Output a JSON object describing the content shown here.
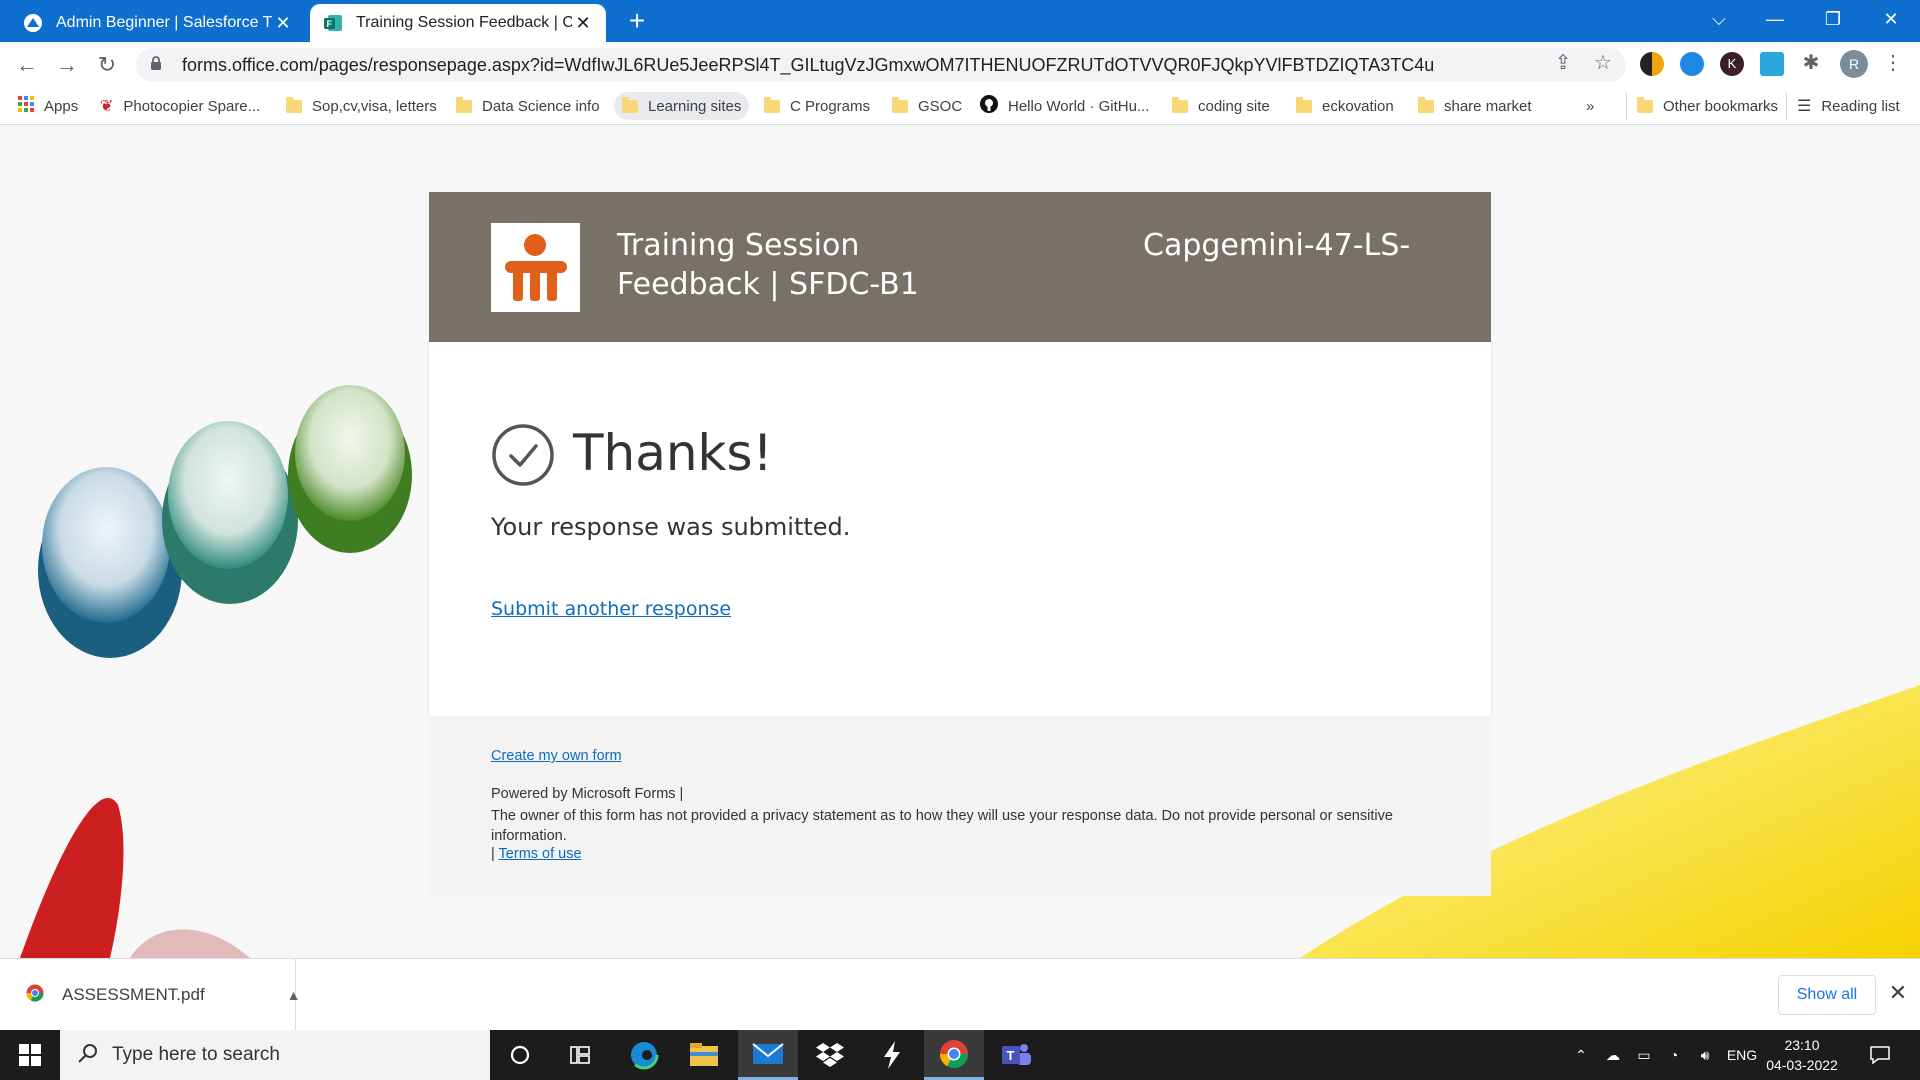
{
  "browser": {
    "tabs": [
      {
        "title": "Admin Beginner | Salesforce Trail",
        "active": false
      },
      {
        "title": "Training Session Feedback | Capgemini",
        "active": true
      }
    ],
    "new_tab": "+",
    "window_controls": {
      "tab_search": "⌵",
      "minimize": "—",
      "restore": "❐",
      "close": "✕"
    },
    "url": "forms.office.com/pages/responsepage.aspx?id=WdfIwJL6RUe5JeeRPSl4T_GILtugVzJGmxwOM7ITHENUOFZRUTdOTVVQR0FJQkpYVlFBTDZIQTA3TC4u",
    "profile_initial": "R",
    "ext_k": "K",
    "bookmarks": [
      {
        "label": "Apps",
        "icon": "apps-grid-icon"
      },
      {
        "label": "Photocopier Spare...",
        "icon": "photocopier-site-icon"
      },
      {
        "label": "Sop,cv,visa, letters",
        "icon": "folder-icon"
      },
      {
        "label": "Data Science info",
        "icon": "folder-icon"
      },
      {
        "label": "Learning sites",
        "icon": "folder-icon"
      },
      {
        "label": "C Programs",
        "icon": "folder-icon"
      },
      {
        "label": "GSOC",
        "icon": "folder-icon"
      },
      {
        "label": "Hello World · GitHu...",
        "icon": "github-icon"
      },
      {
        "label": "coding site",
        "icon": "folder-icon"
      },
      {
        "label": "eckovation",
        "icon": "folder-icon"
      },
      {
        "label": "share market",
        "icon": "folder-icon"
      }
    ],
    "overflow": "»",
    "other_bookmarks": "Other bookmarks",
    "reading_list": "Reading list"
  },
  "form": {
    "title": "Training Session Feedback | SFDC-B1",
    "subtitle": "Capgemini-47-LS-",
    "thanks": "Thanks!",
    "submitted": "Your response was submitted.",
    "submit_another": "Submit another response",
    "footer": {
      "create_form": "Create my own form",
      "powered_by": "Powered by Microsoft Forms |",
      "privacy": "The owner of this form has not provided a privacy statement as to how they will use your response data. Do not provide personal or sensitive information.",
      "terms_prefix": "| ",
      "terms": "Terms of use"
    },
    "colors": {
      "header_bg": "#777168",
      "link": "#0f6cbd",
      "logo_orange": "#e0601b"
    }
  },
  "downloads": {
    "file": "ASSESSMENT.pdf",
    "show_all": "Show all",
    "close": "✕"
  },
  "taskbar": {
    "search_placeholder": "Type here to search",
    "language": "ENG",
    "time": "23:10",
    "date": "04-03-2022",
    "pinned": [
      "cortana-icon",
      "task-view-icon",
      "edge-icon",
      "file-explorer-icon",
      "mail-icon",
      "dropbox-icon",
      "sfdx-icon",
      "chrome-icon",
      "teams-icon"
    ]
  }
}
